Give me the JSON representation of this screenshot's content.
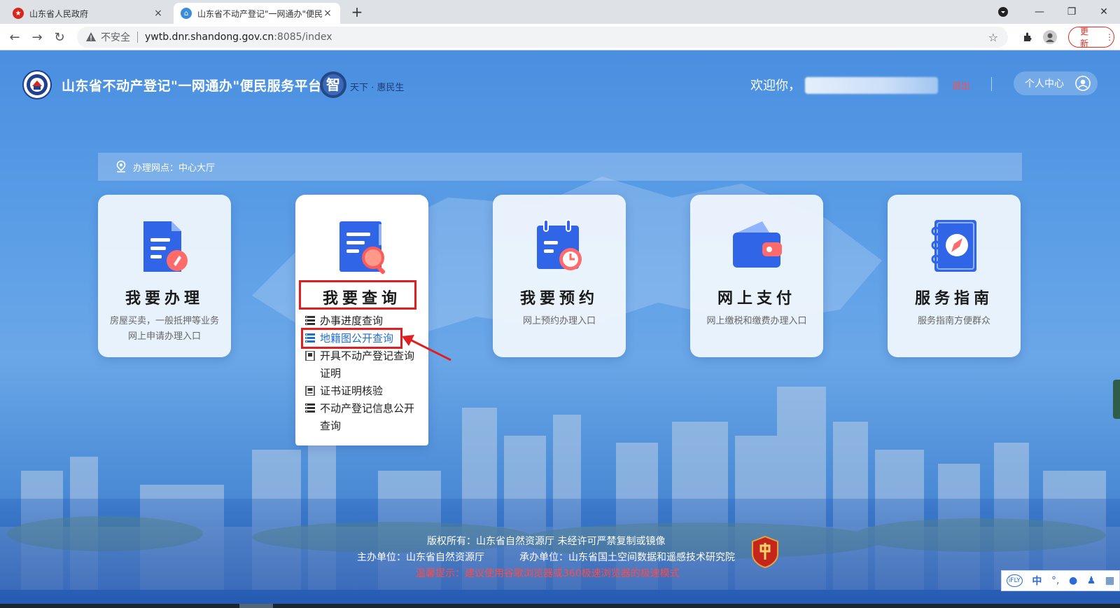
{
  "browser": {
    "tabs": [
      {
        "title": "山东省人民政府",
        "close": "×"
      },
      {
        "title": "山东省不动产登记\"一网通办\"便民",
        "close": "×"
      }
    ],
    "new_tab": "+",
    "window_controls": {
      "minimize": "—",
      "restore": "❐",
      "close": "✕"
    },
    "nav": {
      "back": "←",
      "forward": "→",
      "reload": "↻"
    },
    "omnibox": {
      "security": "不安全",
      "host": "ywtb.dnr.shandong.gov.cn",
      "path": ":8085/index"
    },
    "update_label": "更新"
  },
  "header": {
    "site_title": "山东省不动产登记\"一网通办\"便民服务平台",
    "slogan_char": "智",
    "slogan_rest": "天下 · 惠民生",
    "welcome": "欢迎你，",
    "logout": "退出",
    "personal_center": "个人中心"
  },
  "location": {
    "label": "办理网点：中心大厅"
  },
  "cards": [
    {
      "title": "我要办理",
      "desc": "房屋买卖，一般抵押等业务网上申请办理入口"
    },
    {
      "title": "我要查询",
      "submenu": [
        "办事进度查询",
        "地籍图公开查询",
        "开具不动产登记查询证明",
        "证书证明核验",
        "不动产登记信息公开查询"
      ]
    },
    {
      "title": "我要预约",
      "desc": "网上预约办理入口"
    },
    {
      "title": "网上支付",
      "desc": "网上缴税和缴费办理入口"
    },
    {
      "title": "服务指南",
      "desc": "服务指南方便群众"
    }
  ],
  "footer": {
    "copyright": "版权所有：山东省自然资源厅 未经许可严禁复制或镜像",
    "host_org": "主办单位：山东省自然资源厅",
    "undertake_org": "承办单位：山东省国土空间数据和遥感技术研究院",
    "tip": "温馨提示：建议使用谷歌浏览器或360极速浏览器的极速模式"
  },
  "ime": {
    "logo": "iFLY",
    "lang": "中"
  },
  "colors": {
    "page_blue": "#4a8fe0",
    "highlight_red": "#e02020",
    "selected_link": "#1f6fd0",
    "logout_red": "#ff4d4d",
    "tip_red": "#ff4a4a"
  }
}
